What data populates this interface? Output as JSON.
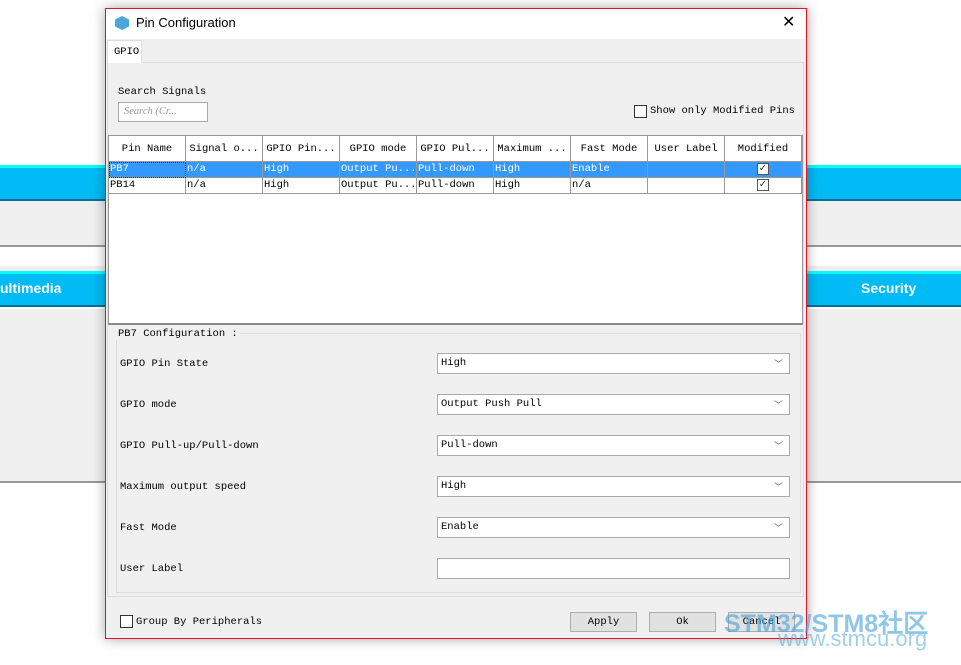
{
  "background": {
    "left_header": "ultimedia",
    "right_header": "Security"
  },
  "dialog": {
    "title": "Pin Configuration",
    "tab": "GPIO",
    "search_label": "Search Signals",
    "search_placeholder": "Search (Cr...",
    "show_modified_label": "Show only Modified Pins",
    "show_modified_checked": false,
    "table": {
      "columns": [
        "Pin Name",
        "Signal o...",
        "GPIO Pin...",
        "GPIO mode",
        "GPIO Pul...",
        "Maximum ...",
        "Fast Mode",
        "User Label",
        "Modified"
      ],
      "rows": [
        {
          "cells": [
            "PB7",
            "n/a",
            "High",
            "Output Pu...",
            "Pull-down",
            "High",
            "Enable",
            ""
          ],
          "modified": true,
          "selected": true
        },
        {
          "cells": [
            "PB14",
            "n/a",
            "High",
            "Output Pu...",
            "Pull-down",
            "High",
            "n/a",
            ""
          ],
          "modified": true,
          "selected": false
        }
      ]
    },
    "config": {
      "title": "PB7 Configuration :",
      "fields": [
        {
          "label": "GPIO Pin State",
          "value": "High"
        },
        {
          "label": "GPIO mode",
          "value": "Output Push Pull"
        },
        {
          "label": "GPIO Pull-up/Pull-down",
          "value": "Pull-down"
        },
        {
          "label": "Maximum output speed",
          "value": "High"
        },
        {
          "label": "Fast Mode",
          "value": "Enable"
        }
      ],
      "user_label": {
        "label": "User Label",
        "value": ""
      }
    },
    "group_by_label": "Group By Peripherals",
    "group_by_checked": false,
    "buttons": {
      "apply": "Apply",
      "ok": "Ok",
      "cancel": "Cancel"
    }
  },
  "watermark": {
    "line1": "STM32/STM8社区",
    "line2": "www.stmcu.org"
  },
  "colors": {
    "accent": "#00bbf5",
    "selection": "#3399ff",
    "dialog_border": "#e81123"
  }
}
